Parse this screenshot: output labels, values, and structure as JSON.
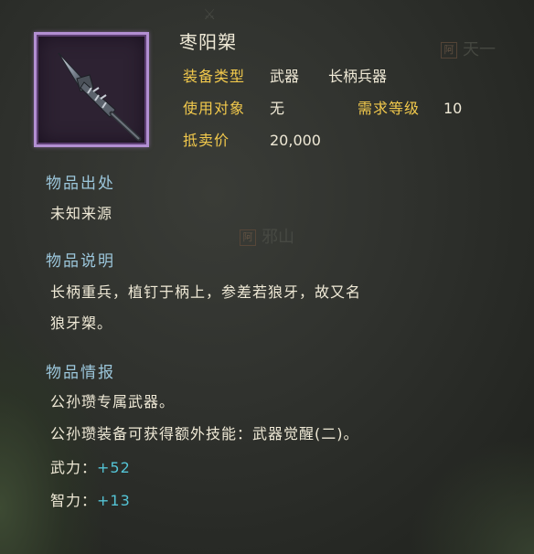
{
  "item": {
    "name": "枣阳槊",
    "icon": "spear-icon",
    "equip_type_label": "装备类型",
    "equip_type_value1": "武器",
    "equip_type_value2": "长柄兵器",
    "target_label": "使用对象",
    "target_value": "无",
    "level_req_label": "需求等级",
    "level_req_value": "10",
    "sell_price_label": "抵卖价",
    "sell_price_value": "20,000"
  },
  "origin": {
    "title": "物品出处",
    "text": "未知来源"
  },
  "description": {
    "title": "物品说明",
    "line1": "长柄重兵，植钉于柄上，参差若狼牙，故又名",
    "line2": "狼牙槊。"
  },
  "intel": {
    "title": "物品情报",
    "line1": "公孙瓒专属武器。",
    "line2": "公孙瓒装备可获得额外技能：武器觉醒(二)。",
    "stats": [
      {
        "label": "武力：",
        "value": "+52"
      },
      {
        "label": "智力：",
        "value": "+13"
      }
    ]
  },
  "map_labels": {
    "place1": "天一",
    "place2": "邪山",
    "seal1": "阿",
    "seal2": "阿"
  },
  "colors": {
    "label": "#f2c94c",
    "section": "#9cc7dc",
    "stat_value": "#54c4d6",
    "frame": "#b28fd2"
  }
}
